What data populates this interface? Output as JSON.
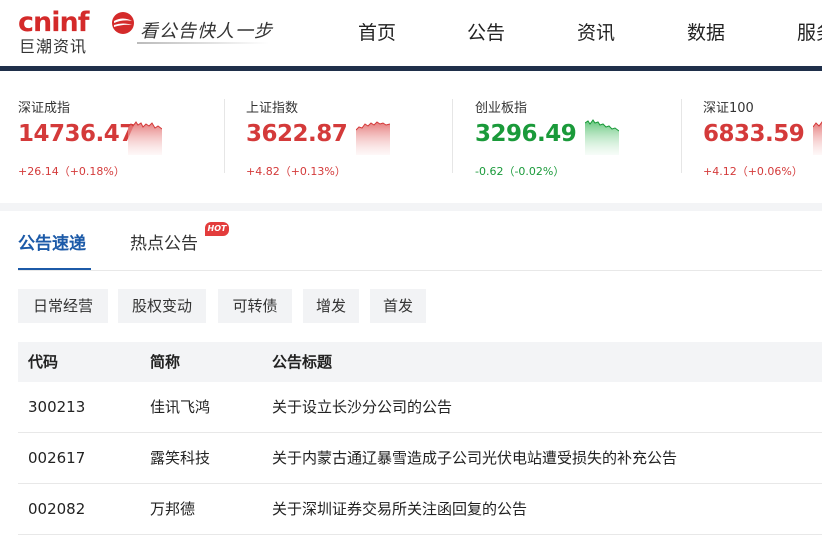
{
  "header": {
    "logo_text": "cninf",
    "logo_sub": "巨潮资讯",
    "slogan": "看公告快人一步",
    "nav": [
      "首页",
      "公告",
      "资讯",
      "数据",
      "服务"
    ]
  },
  "indices": [
    {
      "name": "深证成指",
      "value": "14736.47",
      "change": "+26.14（+0.18%）",
      "trend": "up"
    },
    {
      "name": "上证指数",
      "value": "3622.87",
      "change": "+4.82（+0.13%）",
      "trend": "up"
    },
    {
      "name": "创业板指",
      "value": "3296.49",
      "change": "-0.62（-0.02%）",
      "trend": "down"
    },
    {
      "name": "深证100",
      "value": "6833.59",
      "change": "+4.12（+0.06%）",
      "trend": "up"
    }
  ],
  "colors": {
    "up": "#d43a3a",
    "down": "#1a9a3a",
    "accent": "#1c5aa8",
    "header_bar": "#1f2f4a"
  },
  "tabs": {
    "active": "公告速递",
    "second": "热点公告",
    "hot_badge": "HOT"
  },
  "filters": [
    "日常经营",
    "股权变动",
    "可转债",
    "增发",
    "首发"
  ],
  "table": {
    "columns": [
      "代码",
      "简称",
      "公告标题"
    ],
    "rows": [
      {
        "code": "300213",
        "name": "佳讯飞鸿",
        "title": "关于设立长沙分公司的公告"
      },
      {
        "code": "002617",
        "name": "露笑科技",
        "title": "关于内蒙古通辽暴雪造成子公司光伏电站遭受损失的补充公告"
      },
      {
        "code": "002082",
        "name": "万邦德",
        "title": "关于深圳证券交易所关注函回复的公告"
      }
    ]
  }
}
